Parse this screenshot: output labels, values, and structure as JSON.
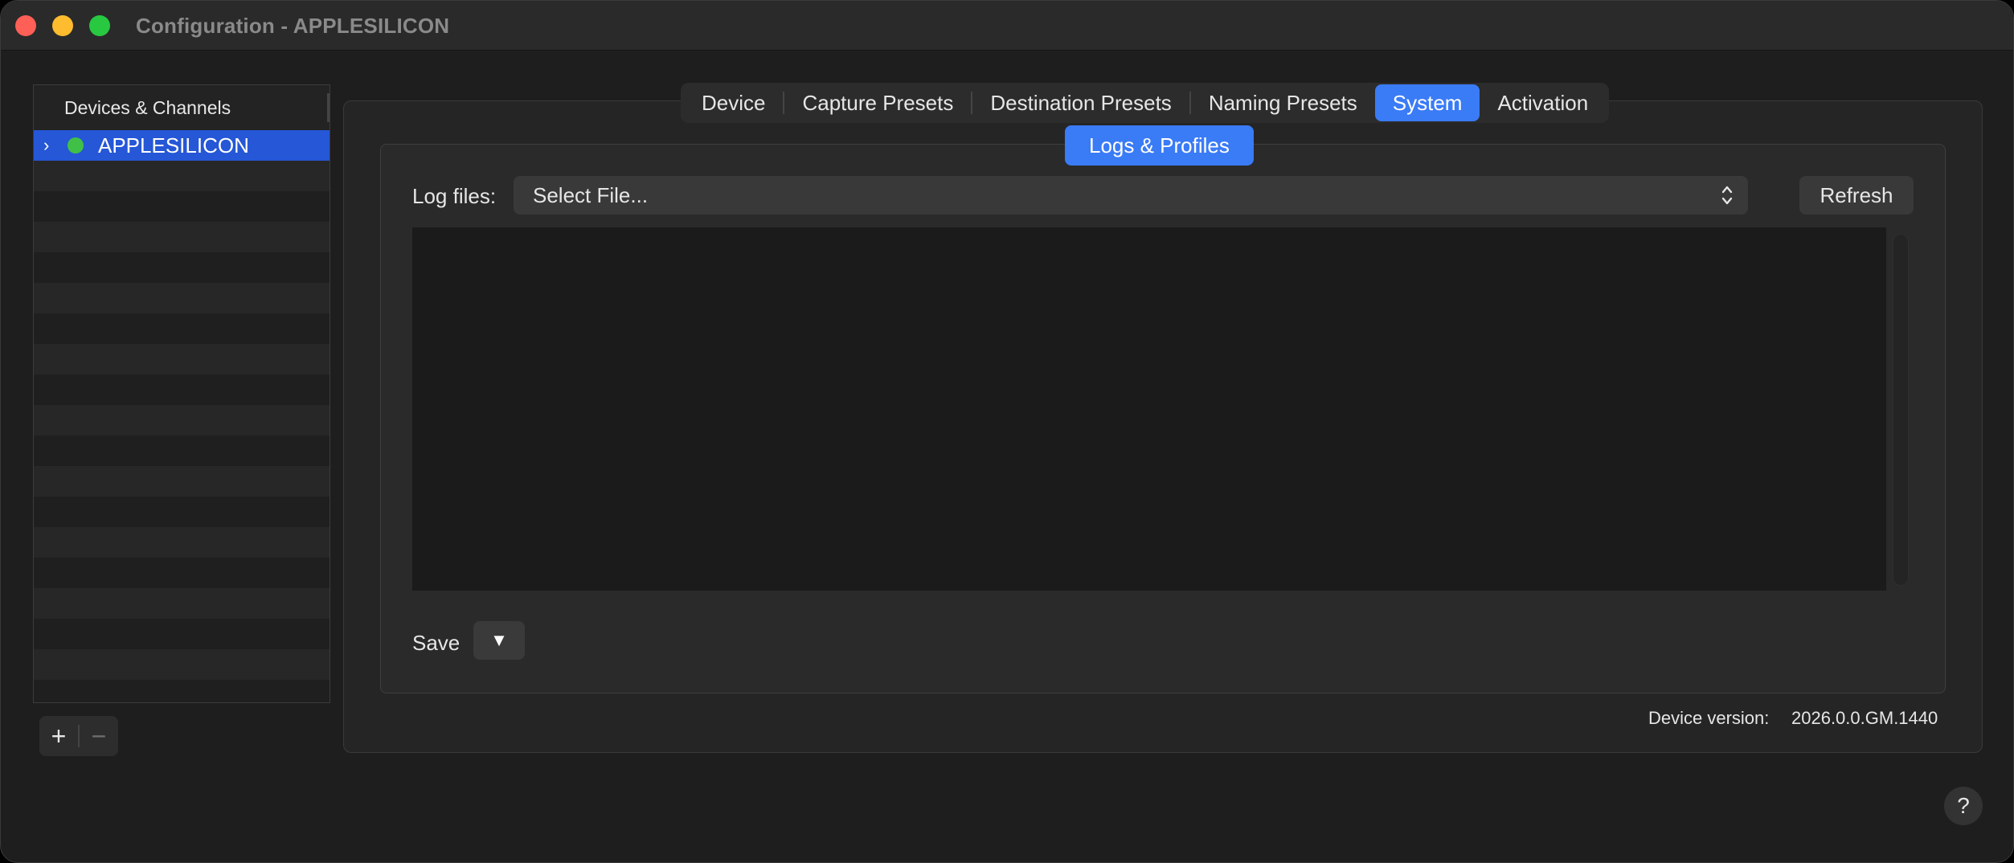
{
  "window": {
    "title": "Configuration - APPLESILICON"
  },
  "sidebar": {
    "header": "Devices & Channels",
    "items": [
      {
        "label": "APPLESILICON",
        "status": "online",
        "status_color": "#41c047",
        "selected": true
      }
    ],
    "add_label": "+",
    "remove_label": "−"
  },
  "tabs": [
    {
      "label": "Device",
      "active": false
    },
    {
      "label": "Capture Presets",
      "active": false
    },
    {
      "label": "Destination Presets",
      "active": false
    },
    {
      "label": "Naming Presets",
      "active": false
    },
    {
      "label": "System",
      "active": true
    },
    {
      "label": "Activation",
      "active": false
    }
  ],
  "system": {
    "subtab_label": "Logs & Profiles",
    "log_files_label": "Log files:",
    "file_select_value": "Select File...",
    "refresh_label": "Refresh",
    "save_label": "Save",
    "save_menu_glyph": "▼",
    "device_version_label": "Device version:",
    "device_version_value": "2026.0.0.GM.1440"
  },
  "help_label": "?",
  "colors": {
    "accent": "#3a7bf6",
    "selection": "#2557d6",
    "status_online": "#41c047",
    "close": "#fe5f57",
    "minimize": "#febc2e",
    "zoom": "#28c840"
  }
}
